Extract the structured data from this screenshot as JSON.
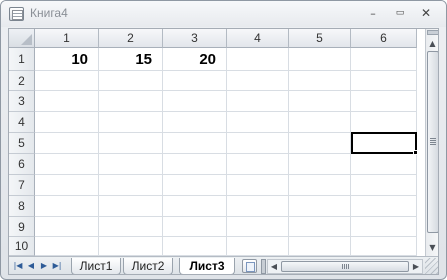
{
  "window": {
    "title": "Книга4",
    "min_symbol": "–",
    "max_symbol": "▭",
    "close_symbol": "✕"
  },
  "columns": [
    {
      "label": "1"
    },
    {
      "label": "2"
    },
    {
      "label": "3"
    },
    {
      "label": "4"
    },
    {
      "label": "5"
    },
    {
      "label": "6"
    }
  ],
  "rows": [
    {
      "label": "1",
      "cells": [
        "10",
        "15",
        "20",
        "",
        "",
        ""
      ]
    },
    {
      "label": "2",
      "cells": [
        "",
        "",
        "",
        "",
        "",
        ""
      ]
    },
    {
      "label": "3",
      "cells": [
        "",
        "",
        "",
        "",
        "",
        ""
      ]
    },
    {
      "label": "4",
      "cells": [
        "",
        "",
        "",
        "",
        "",
        ""
      ]
    },
    {
      "label": "5",
      "cells": [
        "",
        "",
        "",
        "",
        "",
        ""
      ]
    },
    {
      "label": "6",
      "cells": [
        "",
        "",
        "",
        "",
        "",
        ""
      ]
    },
    {
      "label": "7",
      "cells": [
        "",
        "",
        "",
        "",
        "",
        ""
      ]
    },
    {
      "label": "8",
      "cells": [
        "",
        "",
        "",
        "",
        "",
        ""
      ]
    },
    {
      "label": "9",
      "cells": [
        "",
        "",
        "",
        "",
        "",
        ""
      ]
    },
    {
      "label": "10",
      "cells": [
        "",
        "",
        "",
        "",
        "",
        ""
      ]
    }
  ],
  "selection": {
    "row": "5",
    "column": "6"
  },
  "sheet_nav": {
    "first": "|◀",
    "prev": "◀",
    "next": "▶",
    "last": "▶|"
  },
  "sheets": [
    {
      "label": "Лист1",
      "active": false
    },
    {
      "label": "Лист2",
      "active": false
    },
    {
      "label": "Лист3",
      "active": true
    }
  ],
  "scroll": {
    "up": "▲",
    "down": "▼",
    "left": "◀",
    "right": "▶"
  },
  "colors": {
    "selection_border": "#000000",
    "header_bg": "#e2e6eb",
    "grid_line": "#d8dde3",
    "nav_arrow": "#2e5b97"
  }
}
